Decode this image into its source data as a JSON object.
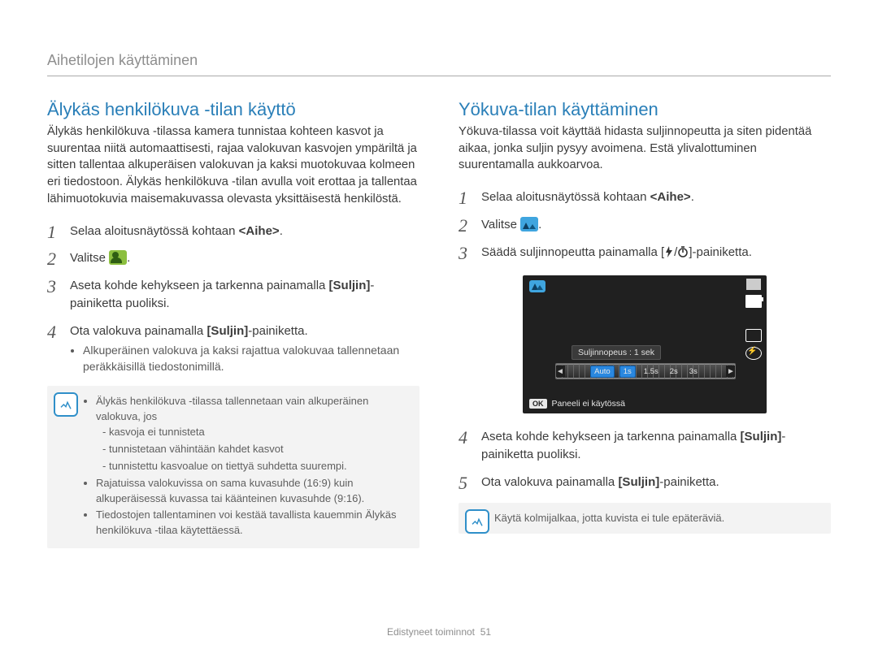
{
  "header": {
    "title": "Aihetilojen käyttäminen"
  },
  "left": {
    "heading": "Älykäs henkilökuva -tilan käyttö",
    "intro": "Älykäs henkilökuva -tilassa kamera tunnistaa kohteen kasvot ja suurentaa niitä automaattisesti, rajaa valokuvan kasvojen ympäriltä ja sitten tallentaa alkuperäisen valokuvan ja kaksi muotokuvaa kolmeen eri tiedostoon. Älykäs henkilökuva -tilan avulla voit erottaa ja tallentaa lähimuotokuvia maisemakuvassa olevasta yksittäisestä henkilöstä.",
    "step1_a": "Selaa aloitusnäytössä kohtaan ",
    "step1_b": "<Aihe>",
    "step1_c": ".",
    "step2_a": "Valitse ",
    "step2_b": ".",
    "step3_a": "Aseta kohde kehykseen ja tarkenna painamalla ",
    "step3_b": "[Suljin]",
    "step3_c": "-painiketta puoliksi.",
    "step4_a": "Ota valokuva painamalla ",
    "step4_b": "[Suljin]",
    "step4_c": "-painiketta.",
    "step4_bullet": "Alkuperäinen valokuva ja kaksi rajattua valokuvaa tallennetaan peräkkäisillä tiedostonimillä.",
    "note": {
      "b1": "Älykäs henkilökuva -tilassa tallennetaan vain alkuperäinen valokuva, jos",
      "b1a": "kasvoja ei tunnisteta",
      "b1b": "tunnistetaan vähintään kahdet kasvot",
      "b1c": "tunnistettu kasvoalue on tiettyä suhdetta suurempi.",
      "b2": "Rajatuissa valokuvissa on sama kuvasuhde (16:9) kuin alkuperäisessä kuvassa tai käänteinen kuvasuhde (9:16).",
      "b3": "Tiedostojen tallentaminen voi kestää tavallista kauemmin Älykäs henkilökuva -tilaa käytettäessä."
    }
  },
  "right": {
    "heading": "Yökuva-tilan käyttäminen",
    "intro": "Yökuva-tilassa voit käyttää hidasta suljinnopeutta ja siten pidentää aikaa, jonka suljin pysyy avoimena. Estä ylivalottuminen suurentamalla aukkoarvoa.",
    "step1_a": "Selaa aloitusnäytössä kohtaan ",
    "step1_b": "<Aihe>",
    "step1_c": ".",
    "step2_a": "Valitse ",
    "step2_b": ".",
    "step3_a": "Säädä suljinnopeutta painamalla [",
    "step3_b": "/",
    "step3_c": "]-painiketta.",
    "lcd": {
      "label": "Suljinnopeus : 1 sek",
      "opts": [
        "Auto",
        "1s",
        "1.5s",
        "2s",
        "3s"
      ],
      "ok": "OK",
      "bottom": "Paneeli ei käytössä"
    },
    "step4_a": "Aseta kohde kehykseen ja tarkenna painamalla ",
    "step4_b": "[Suljin]",
    "step4_c": "-painiketta puoliksi.",
    "step5_a": "Ota valokuva painamalla ",
    "step5_b": "[Suljin]",
    "step5_c": "-painiketta.",
    "note": "Käytä kolmijalkaa, jotta kuvista ei tule epäteräviä."
  },
  "footer": {
    "section": "Edistyneet toiminnot",
    "page": "51"
  }
}
